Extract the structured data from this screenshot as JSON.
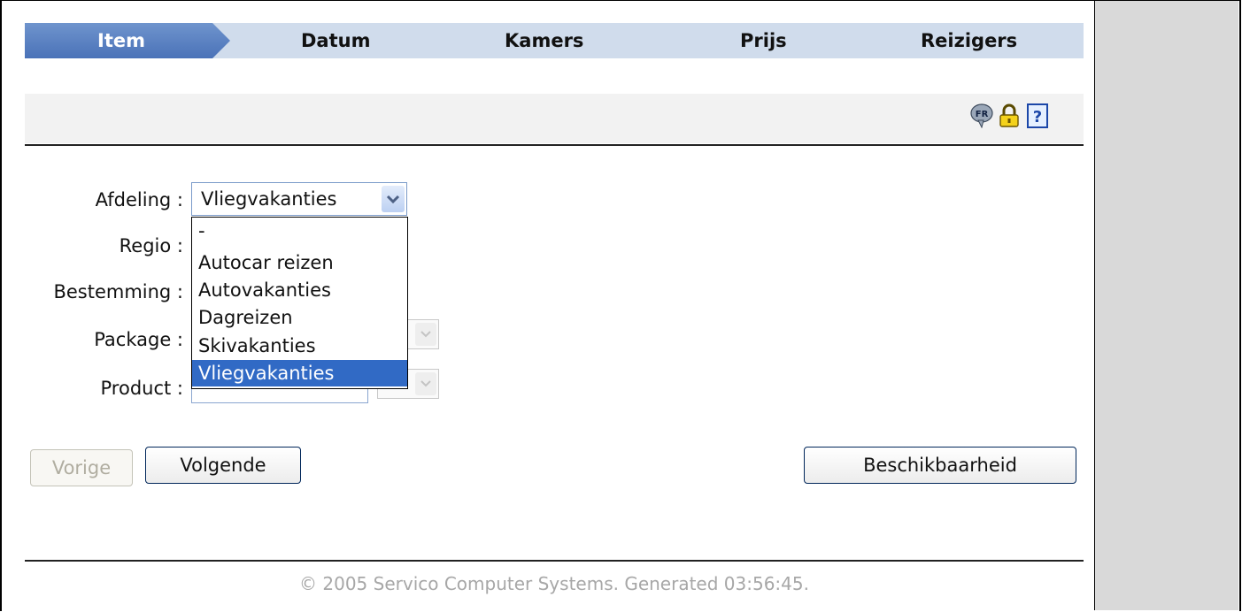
{
  "wizard": {
    "steps": [
      {
        "label": "Item",
        "active": true
      },
      {
        "label": "Datum",
        "active": false
      },
      {
        "label": "Kamers",
        "active": false
      },
      {
        "label": "Prijs",
        "active": false
      },
      {
        "label": "Reizigers",
        "active": false
      }
    ]
  },
  "toolbar": {
    "icons": [
      {
        "name": "language-fr-icon",
        "text": "FR"
      },
      {
        "name": "lock-icon"
      },
      {
        "name": "help-icon",
        "text": "?"
      }
    ]
  },
  "form": {
    "labels": {
      "afdeling": "Afdeling :",
      "regio": "Regio :",
      "bestemming": "Bestemming :",
      "package": "Package :",
      "product": "Product :"
    },
    "afdeling_value": "Vliegvakanties",
    "afdeling_options": [
      "-",
      "Autocar reizen",
      "Autovakanties",
      "Dagreizen",
      "Skivakanties",
      "Vliegvakanties"
    ],
    "afdeling_selected_option": "Vliegvakanties"
  },
  "buttons": {
    "previous": "Vorige",
    "next": "Volgende",
    "availability": "Beschikbaarheid"
  },
  "footer": {
    "text": "© 2005 Servico Computer Systems. Generated 03:56:45."
  },
  "colors": {
    "active_step": "#4a72b8",
    "step_bar": "#d0dcec",
    "selected_option": "#316ac5",
    "footer_text": "#a7a7a7"
  }
}
